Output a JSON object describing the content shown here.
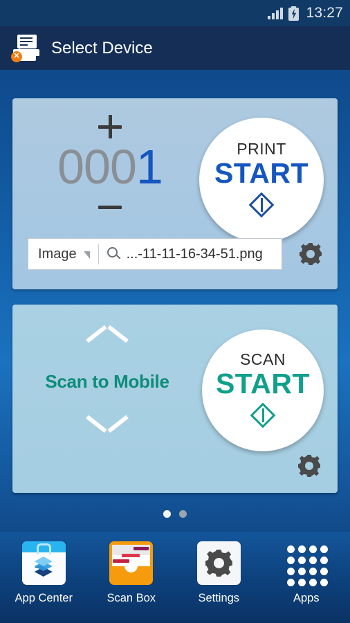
{
  "statusbar": {
    "time": "13:27",
    "signal_icon": "signal-bars-icon",
    "battery_icon": "battery-charging-icon"
  },
  "header": {
    "title": "Select Device",
    "icon": "printer-error-icon",
    "badge": "✕"
  },
  "print_card": {
    "counter": {
      "value_inactive": "000",
      "value_active": "1",
      "plus_label": "+",
      "minus_label": "−"
    },
    "start_button": {
      "sub_label": "PRINT",
      "main_label": "START",
      "icon": "power-diamond-icon",
      "color": "#1556c0"
    },
    "file_row": {
      "type_label": "Image",
      "caret_icon": "caret-down-icon",
      "search_icon": "search-icon",
      "file_name": "...-11-11-16-34-51.png"
    },
    "gear_icon": "gear-icon"
  },
  "scan_card": {
    "label": "Scan to Mobile",
    "chevron_up_icon": "chevron-up-icon",
    "chevron_down_icon": "chevron-down-icon",
    "start_button": {
      "sub_label": "SCAN",
      "main_label": "START",
      "icon": "power-diamond-icon",
      "color": "#11a08c"
    },
    "gear_icon": "gear-icon"
  },
  "page_indicator": {
    "total": 2,
    "current": 1
  },
  "bottom_nav": {
    "items": [
      {
        "label": "App Center",
        "icon": "app-center-icon"
      },
      {
        "label": "Scan Box",
        "icon": "scan-box-icon"
      },
      {
        "label": "Settings",
        "icon": "gear-icon"
      },
      {
        "label": "Apps",
        "icon": "apps-grid-icon"
      }
    ]
  }
}
